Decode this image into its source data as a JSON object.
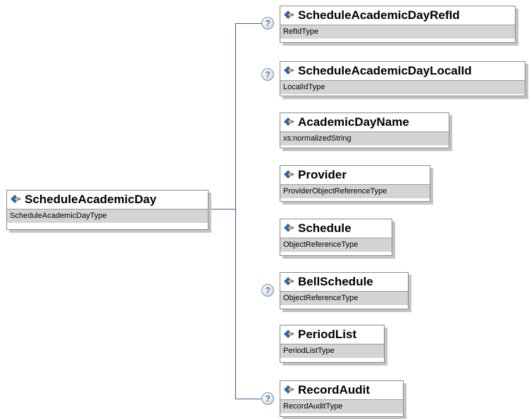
{
  "root": {
    "name": "ScheduleAcademicDay",
    "type": "ScheduleAcademicDayType"
  },
  "optional_marker": "?",
  "children": [
    {
      "name": "ScheduleAcademicDayRefId",
      "type": "RefIdType",
      "optional": true
    },
    {
      "name": "ScheduleAcademicDayLocalId",
      "type": "LocalIdType",
      "optional": true
    },
    {
      "name": "AcademicDayName",
      "type": "xs:normalizedString",
      "optional": false
    },
    {
      "name": "Provider",
      "type": "ProviderObjectReferenceType",
      "optional": false
    },
    {
      "name": "Schedule",
      "type": "ObjectReferenceType",
      "optional": false
    },
    {
      "name": "BellSchedule",
      "type": "ObjectReferenceType",
      "optional": true
    },
    {
      "name": "PeriodList",
      "type": "PeriodListType",
      "optional": false
    },
    {
      "name": "RecordAudit",
      "type": "RecordAuditType",
      "optional": true
    }
  ],
  "colors": {
    "connector": "#3d5f8f",
    "icon": "#2f64b3",
    "icon_accent": "#f2b233",
    "type_bg": "#d4d4d4"
  }
}
